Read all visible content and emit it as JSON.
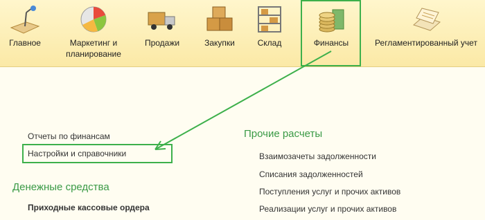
{
  "toolbar": {
    "sections": [
      {
        "label": "Главное",
        "icon": "desk-lamp-icon"
      },
      {
        "label": "Маркетинг и\nпланирование",
        "icon": "pie-chart-icon"
      },
      {
        "label": "Продажи",
        "icon": "delivery-truck-icon"
      },
      {
        "label": "Закупки",
        "icon": "boxes-icon"
      },
      {
        "label": "Склад",
        "icon": "warehouse-shelf-icon"
      },
      {
        "label": "Финансы",
        "icon": "coins-icon"
      },
      {
        "label": "Регламентированный учет",
        "icon": "ledger-documents-icon"
      }
    ],
    "active": "Финансы"
  },
  "left_links": {
    "reports": "Отчеты по финансам",
    "settings": "Настройки и справочники"
  },
  "groups": {
    "money": {
      "title": "Денежные средства",
      "items": [
        "Приходные кассовые ордера"
      ]
    },
    "other": {
      "title": "Прочие расчеты",
      "items": [
        "Взаимозачеты задолженности",
        "Списания задолженностей",
        "Поступления услуг и прочих активов",
        "Реализации услуг и прочих активов"
      ]
    }
  },
  "colors": {
    "highlight": "#3db04b",
    "group_title": "#3a9a46",
    "toolbar_bg": "#fbe9a6"
  }
}
